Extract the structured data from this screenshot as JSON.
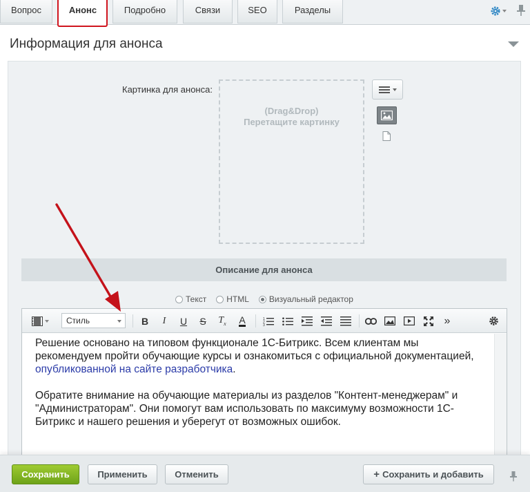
{
  "tabs": [
    {
      "label": "Вопрос",
      "active": false
    },
    {
      "label": "Анонс",
      "active": true
    },
    {
      "label": "Подробно",
      "active": false
    },
    {
      "label": "Связи",
      "active": false
    },
    {
      "label": "SEO",
      "active": false
    },
    {
      "label": "Разделы",
      "active": false
    }
  ],
  "section": {
    "title": "Информация для анонса"
  },
  "picture": {
    "label": "Картинка для анонса:",
    "drop_line1": "(Drag&Drop)",
    "drop_line2": "Перетащите картинку"
  },
  "description": {
    "header": "Описание для анонса"
  },
  "modes": [
    {
      "label": "Текст",
      "selected": false
    },
    {
      "label": "HTML",
      "selected": false
    },
    {
      "label": "Визуальный редактор",
      "selected": true
    }
  ],
  "toolbar": {
    "style_select": "Стиль",
    "more": "»"
  },
  "content": {
    "p1_text": "Решение основано на типовом функционале 1С-Битрикс. Всем клиентам мы рекомендуем пройти обучающие курсы и ознакомиться с официальной документацией, ",
    "p1_link": "опубликованной на сайте разработчика",
    "p1_end": ".",
    "p2": "Обратите внимание на обучающие материалы из разделов \"Контент-менеджерам\" и \"Администраторам\". Они помогут вам использовать по максимуму возможности 1С-Битрикс и нашего решения и уберегут от возможных ошибок."
  },
  "footer": {
    "save": "Сохранить",
    "apply": "Применить",
    "cancel": "Отменить",
    "save_add": "Сохранить и добавить"
  },
  "colors": {
    "accent_green": "#7ab21f",
    "highlight_red": "#d0141e",
    "link": "#2b3ba8"
  }
}
